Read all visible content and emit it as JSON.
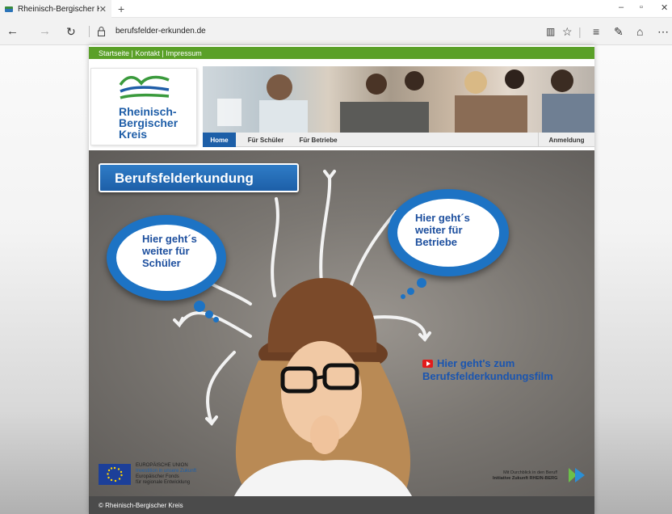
{
  "browser": {
    "tab_title": "Rheinisch-Bergischer Kr",
    "tab_close": "✕",
    "new_tab": "+",
    "url": "berufsfelder-erkunden.de",
    "window_controls": {
      "minimize": "–",
      "restore": "▫",
      "close": "✕"
    },
    "toolbar_icons": [
      "reading-view-icon",
      "favorite-star-icon",
      "hub-icon",
      "web-note-icon",
      "share-icon",
      "more-icon"
    ]
  },
  "site": {
    "topnav": {
      "items": [
        "Startseite",
        "Kontakt",
        "Impressum"
      ],
      "separator": " | "
    },
    "logo": {
      "lines": [
        "Rheinisch-",
        "Bergischer",
        "Kreis"
      ],
      "color": "#1f5ea8"
    },
    "nav": {
      "home": "Home",
      "schueler": "Für Schüler",
      "betriebe": "Für Betriebe",
      "anmeldung": "Anmeldung"
    },
    "hero": {
      "title": "Berufsfelderkundung",
      "bubble_left": {
        "lines": [
          "Hier geht´s",
          "weiter für",
          "Schüler"
        ]
      },
      "bubble_right": {
        "lines": [
          "Hier geht´s",
          "weiter für",
          "Betriebe"
        ]
      },
      "film": {
        "lines": [
          "Hier geht's zum",
          "Berufsfelderkundungsfilm"
        ]
      }
    },
    "eu": {
      "lines": [
        "EUROPÄISCHE UNION",
        "Investition in unsere Zukunft",
        "Europäischer Fonds",
        "für regionale Entwicklung"
      ]
    },
    "initiative": {
      "line1": "Mit Durchblick in den Beruf!",
      "line2": "Initiative Zukunft RHEIN-BERG"
    },
    "footer": "© Rheinisch-Bergischer Kreis"
  },
  "colors": {
    "accent_blue": "#1d5fa8",
    "green_bar": "#5aa028",
    "footer": "#4b4b4b"
  }
}
